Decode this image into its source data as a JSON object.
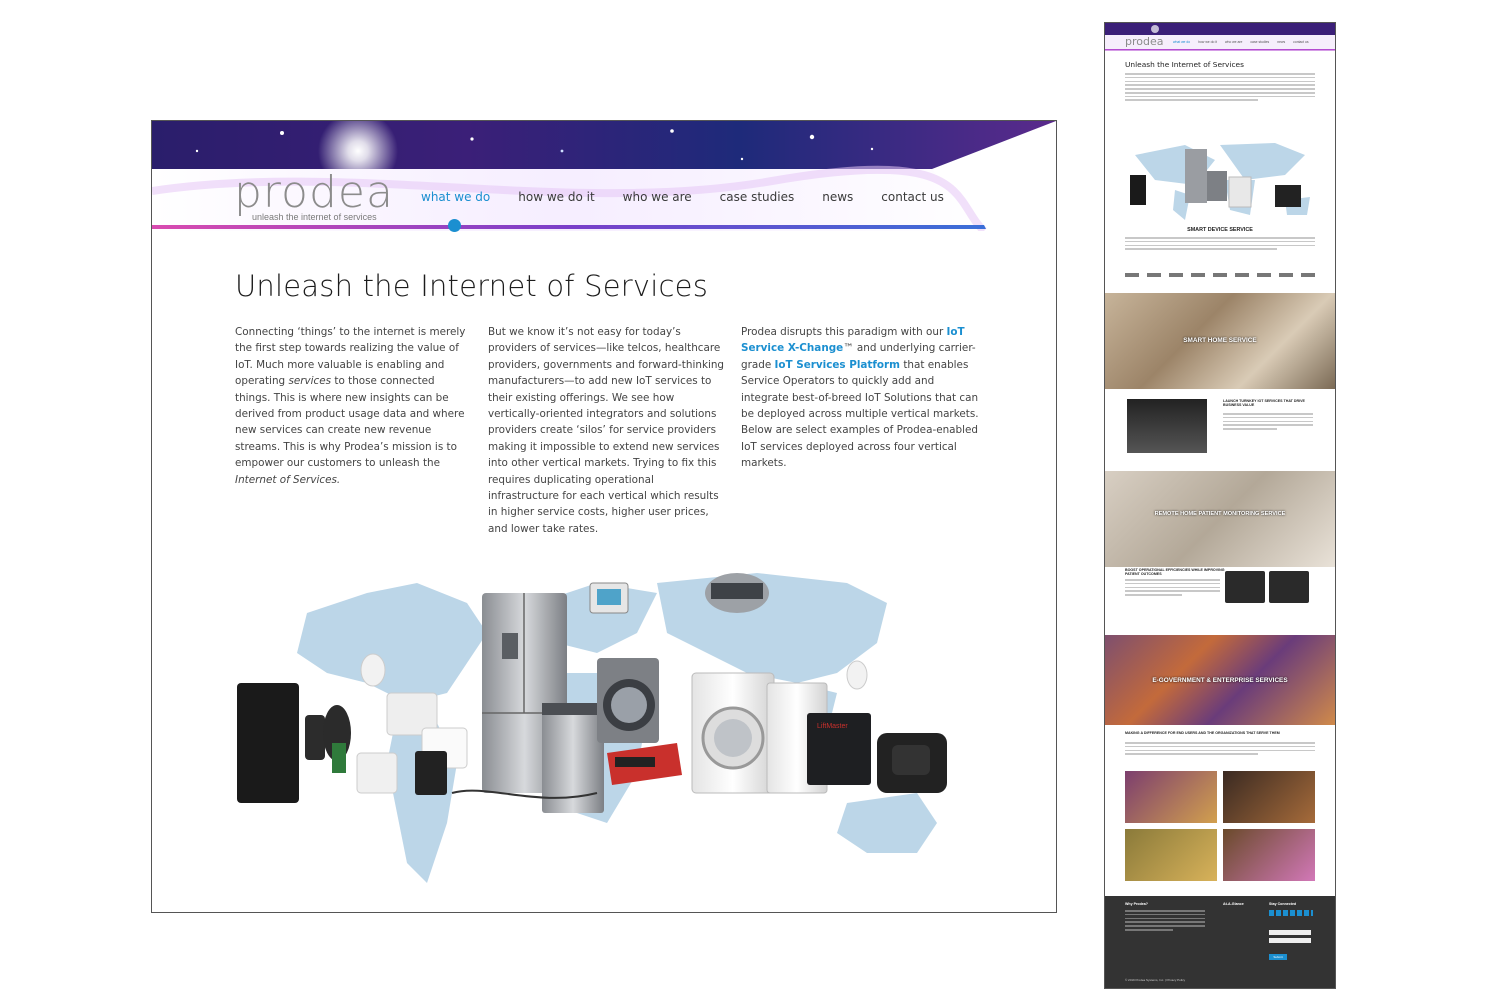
{
  "main": {
    "logo": {
      "word": "prodea",
      "tagline": "unleash the internet of services"
    },
    "nav": [
      {
        "label": "what we do",
        "active": true
      },
      {
        "label": "how we do it",
        "active": false
      },
      {
        "label": "who we are",
        "active": false
      },
      {
        "label": "case studies",
        "active": false
      },
      {
        "label": "news",
        "active": false
      },
      {
        "label": "contact us",
        "active": false
      }
    ],
    "title": "Unleash the Internet of Services",
    "col1": {
      "text": "Connecting ‘things’ to the internet is merely the first step towards realizing the value of IoT. Much more valuable is enabling and operating ",
      "em1": "services",
      "text2": " to those connected things. This is where new insights can be derived from product usage data and where new services can create new revenue streams. This is why Prodea’s mission is to empower our customers to unleash the ",
      "em2": "Internet of Services."
    },
    "col2": {
      "text": "But we know it’s not easy for today’s providers of services—like telcos, healthcare providers, governments and forward-thinking manufacturers—to add new IoT services to their existing offerings. We see how vertically-oriented integrators and solutions providers create ‘silos’ for service providers making it impossible to extend new services into other vertical markets. Trying to fix this requires duplicating operational infrastructure for each vertical which results in higher service costs, higher user prices, and lower take rates."
    },
    "col3": {
      "t1": "Prodea disrupts this paradigm with our ",
      "link1": "IoT Service X-Change",
      "t2": "™ and underlying carrier-grade ",
      "link2": "IoT Services Platform",
      "t3": " that enables Service Operators to quickly add and integrate best-of-breed IoT Solutions that can be deployed across multiple vertical markets. Below are select examples of Prodea-enabled IoT services deployed across four vertical markets."
    },
    "devices_caption": "",
    "device_brand": "LiftMaster"
  },
  "thumb": {
    "logo": "prodea",
    "nav": [
      "what we do",
      "how we do it",
      "who we are",
      "case studies",
      "news",
      "contact us"
    ],
    "title": "Unleash the Internet of Services",
    "sections": {
      "smart_device": "SMART DEVICE SERVICE",
      "smart_home": "SMART HOME SERVICE",
      "smart_home_sub": "LAUNCH TURNKEY IOT SERVICES THAT DRIVE BUSINESS VALUE",
      "remote_home": "REMOTE HOME PATIENT MONITORING SERVICE",
      "remote_sub": "BOOST OPERATIONAL EFFICIENCIES WHILE IMPROVING PATIENT OUTCOMES",
      "egov": "E-GOVERNMENT & ENTERPRISE SERVICES",
      "egov_sub": "MAKING A DIFFERENCE FOR END USERS AND THE ORGANIZATIONS THAT SERVE THEM"
    },
    "footer": {
      "why": "Why Prodea?",
      "glance": "At-A-Glance",
      "connected": "Stay Connected",
      "button": "Submit",
      "copyright": "© 2019 Prodea Systems, Inc. | Privacy Policy"
    }
  },
  "colors": {
    "accent": "#1b8fd0",
    "footer": "#333333"
  }
}
